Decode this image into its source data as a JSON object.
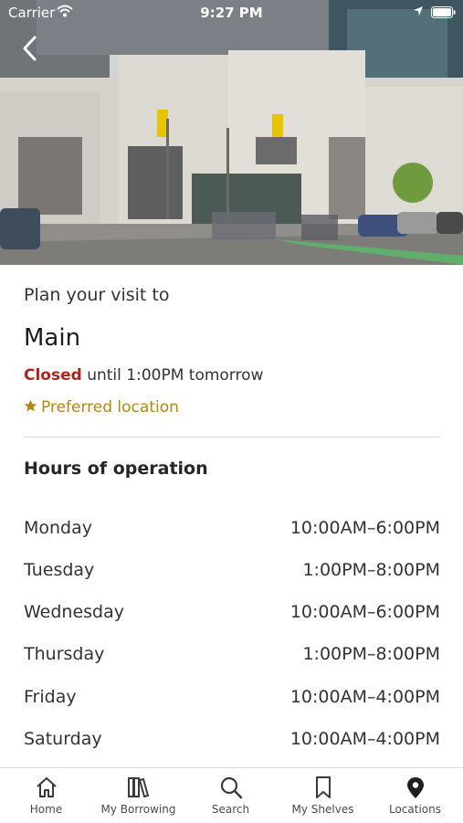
{
  "status_bar": {
    "carrier": "Carrier",
    "time": "9:27 PM"
  },
  "location": {
    "plan_label": "Plan your visit to",
    "name": "Main",
    "status": "Closed",
    "status_detail": "until 1:00PM tomorrow",
    "preferred_label": "Preferred location",
    "hours_title": "Hours of operation",
    "hours": [
      {
        "day": "Monday",
        "time": "10:00AM–6:00PM"
      },
      {
        "day": "Tuesday",
        "time": "1:00PM–8:00PM"
      },
      {
        "day": "Wednesday",
        "time": "10:00AM–6:00PM"
      },
      {
        "day": "Thursday",
        "time": "1:00PM–8:00PM"
      },
      {
        "day": "Friday",
        "time": "10:00AM–4:00PM"
      },
      {
        "day": "Saturday",
        "time": "10:00AM–4:00PM"
      }
    ]
  },
  "tabbar": {
    "items": [
      {
        "label": "Home",
        "icon": "home-icon"
      },
      {
        "label": "My Borrowing",
        "icon": "books-icon"
      },
      {
        "label": "Search",
        "icon": "search-icon"
      },
      {
        "label": "My Shelves",
        "icon": "bookmark-icon"
      },
      {
        "label": "Locations",
        "icon": "map-pin-icon"
      }
    ]
  },
  "colors": {
    "closed": "#b0241c",
    "preferred": "#b8860b",
    "text": "#333333",
    "divider": "#d4d4d4"
  }
}
